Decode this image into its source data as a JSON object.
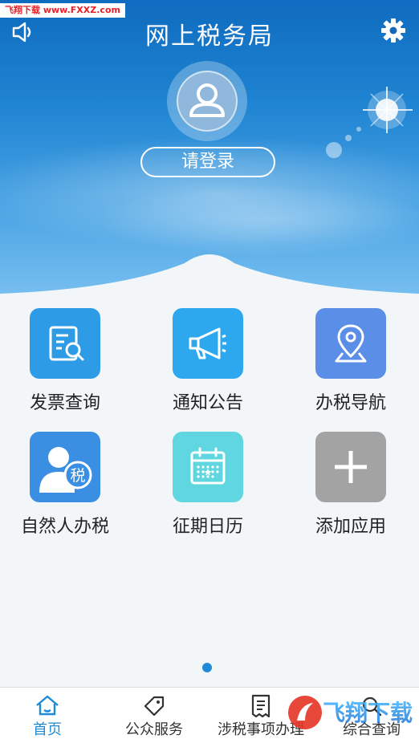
{
  "watermark": "飞翔下载 www.FXXZ.com",
  "header": {
    "title": "网上税务局",
    "login_label": "请登录"
  },
  "apps": [
    {
      "label": "发票查询",
      "icon": "invoice-search-icon",
      "color": "#2d9be6"
    },
    {
      "label": "通知公告",
      "icon": "megaphone-icon",
      "color": "#2da8ef"
    },
    {
      "label": "办税导航",
      "icon": "map-pin-icon",
      "color": "#5b8ee6"
    },
    {
      "label": "自然人办税",
      "icon": "person-tax-icon",
      "color": "#3a8fe3"
    },
    {
      "label": "征期日历",
      "icon": "calendar-icon",
      "color": "#5fd6e0"
    },
    {
      "label": "添加应用",
      "icon": "plus-icon",
      "color": "#a3a3a3"
    }
  ],
  "pager": {
    "pages": 1,
    "current": 1
  },
  "tabs": [
    {
      "label": "首页",
      "icon": "home-icon",
      "active": true
    },
    {
      "label": "公众服务",
      "icon": "tag-icon",
      "active": false
    },
    {
      "label": "涉税事项办理",
      "icon": "receipt-icon",
      "active": false
    },
    {
      "label": "综合查询",
      "icon": "search-icon",
      "active": false
    }
  ],
  "bottom_watermark": "飞翔下载"
}
